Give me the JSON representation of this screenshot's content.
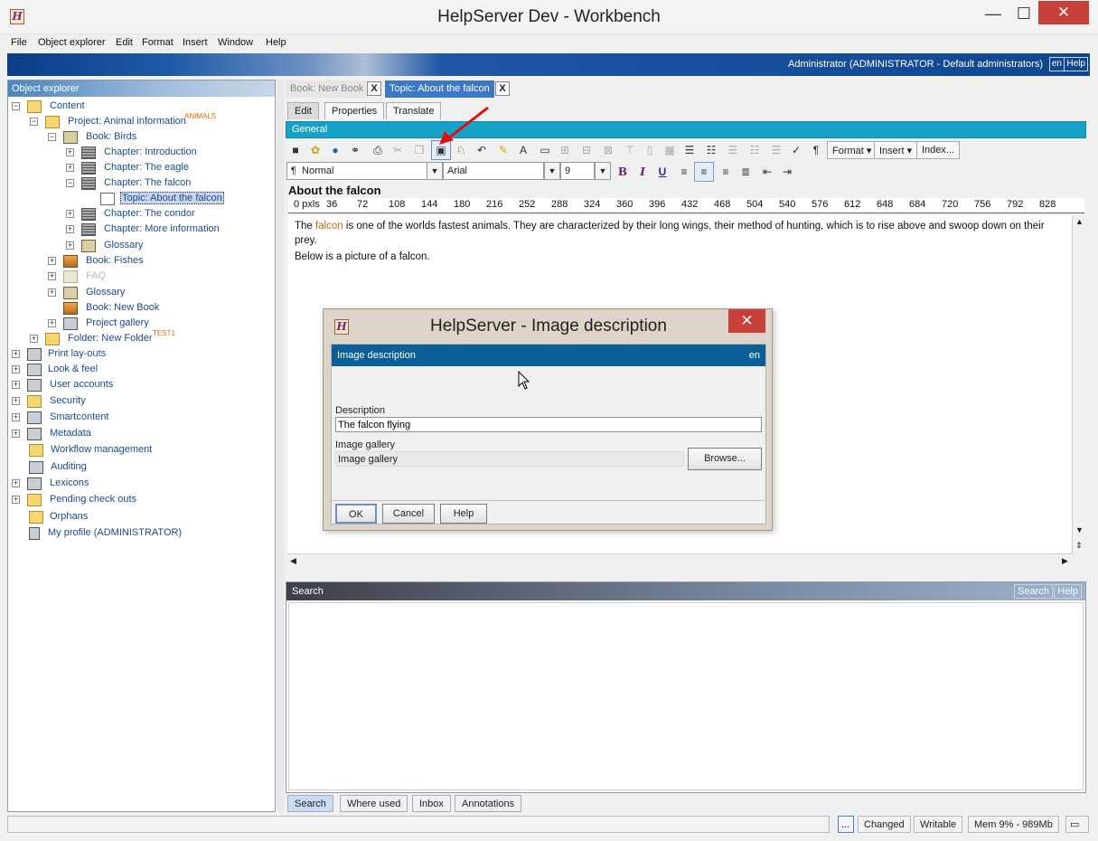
{
  "window": {
    "title": "HelpServer Dev - Workbench",
    "app_icon": "H",
    "minimize": "—",
    "maximize": "☐",
    "close": "✕"
  },
  "menu": [
    "File",
    "Object explorer",
    "Edit",
    "Format",
    "Insert",
    "Window",
    "Help"
  ],
  "banner": {
    "user": "Administrator (ADMINISTRATOR - Default administrators)",
    "lang": "en",
    "help": "Help"
  },
  "object_explorer": {
    "title": "Object explorer",
    "tree": [
      {
        "label": "Content",
        "tag": ""
      },
      {
        "label": "Project: Animal information",
        "tag": "ANIMALS"
      },
      {
        "label": "Book: Birds"
      },
      {
        "label": "Chapter: Introduction"
      },
      {
        "label": "Chapter: The eagle"
      },
      {
        "label": "Chapter: The falcon"
      },
      {
        "label": "Topic: About the falcon"
      },
      {
        "label": "Chapter: The condor"
      },
      {
        "label": "Chapter: More information"
      },
      {
        "label": "Glossary"
      },
      {
        "label": "Book: Fishes"
      },
      {
        "label": "FAQ"
      },
      {
        "label": "Glossary"
      },
      {
        "label": "Book: New Book"
      },
      {
        "label": "Project gallery"
      },
      {
        "label": "Folder: New Folder",
        "tag": "TEST1"
      },
      {
        "label": "Print lay-outs"
      },
      {
        "label": "Look & feel"
      },
      {
        "label": "User accounts"
      },
      {
        "label": "Security"
      },
      {
        "label": "Smartcontent"
      },
      {
        "label": "Metadata"
      },
      {
        "label": "Workflow management"
      },
      {
        "label": "Auditing"
      },
      {
        "label": "Lexicons"
      },
      {
        "label": "Pending check outs"
      },
      {
        "label": "Orphans"
      },
      {
        "label": "My profile (ADMINISTRATOR)"
      }
    ]
  },
  "doc_tabs": [
    {
      "label": "Book: New Book",
      "close": "X"
    },
    {
      "label": "Topic: About the falcon",
      "close": "X"
    }
  ],
  "edit_tabs": [
    "Edit",
    "Properties",
    "Translate"
  ],
  "general_label": "General",
  "toolbar": {
    "format": "Format",
    "insert": "Insert",
    "index": "Index..."
  },
  "style_combo": {
    "paragraph": "Normal",
    "font": "Arial",
    "size": "9",
    "para_mark": "¶"
  },
  "document": {
    "title": "About the falcon",
    "ruler": [
      "0 pxls",
      "36",
      "72",
      "108",
      "144",
      "180",
      "216",
      "252",
      "288",
      "324",
      "360",
      "396",
      "432",
      "468",
      "504",
      "540",
      "576",
      "612",
      "648",
      "684",
      "720",
      "756",
      "792",
      "828"
    ],
    "p1_before": "The ",
    "p1_keyword": "falcon",
    "p1_after": " is one of the worlds fastest animals. They are characterized by their long wings, their method of hunting, which is to rise above and swoop down on their prey.",
    "p2": "Below is a picture of a falcon."
  },
  "search_panel": {
    "title": "Search",
    "search_btn": "Search",
    "help_btn": "Help"
  },
  "bottom_tabs": [
    "Search",
    "Where used",
    "Inbox",
    "Annotations"
  ],
  "status": {
    "dots": "...",
    "changed": "Changed",
    "writable": "Writable",
    "mem": "Mem 9% - 989Mb"
  },
  "dialog": {
    "title": "HelpServer - Image description",
    "header": "Image description",
    "lang": "en",
    "description_label": "Description",
    "description_value": "The falcon flying",
    "gallery_label": "Image gallery",
    "gallery_value": "Image gallery",
    "browse": "Browse...",
    "ok": "OK",
    "cancel": "Cancel",
    "help": "Help",
    "close": "✕"
  }
}
